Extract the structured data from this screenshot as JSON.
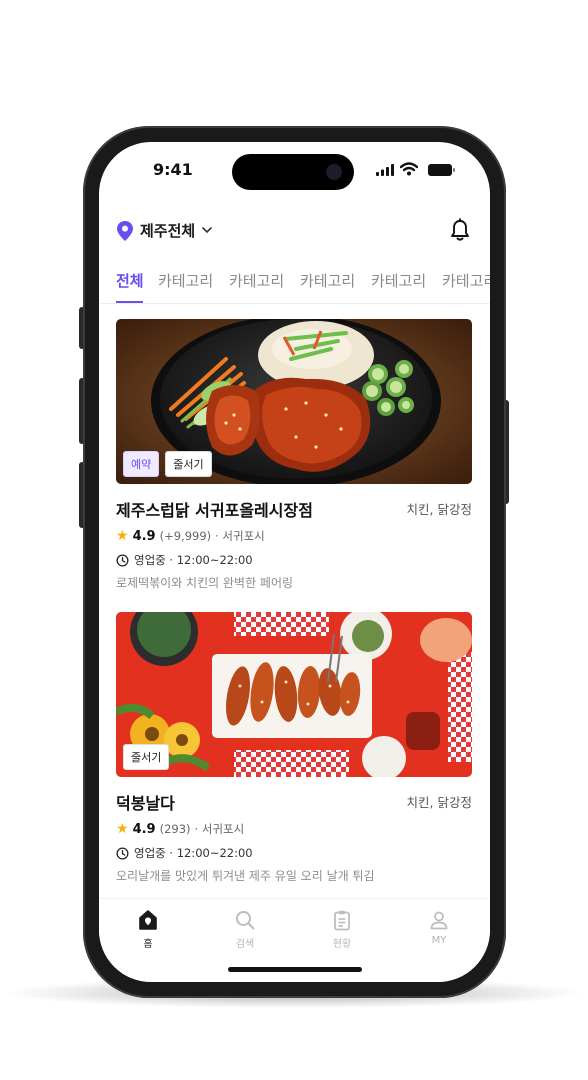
{
  "status_bar": {
    "time": "9:41"
  },
  "header": {
    "location": "제주전체",
    "location_icon": "map-pin-icon",
    "notification_icon": "bell-icon"
  },
  "tabs": [
    {
      "label": "전체",
      "active": true
    },
    {
      "label": "카테고리",
      "active": false
    },
    {
      "label": "카테고리",
      "active": false
    },
    {
      "label": "카테고리",
      "active": false
    },
    {
      "label": "카테고리",
      "active": false
    },
    {
      "label": "카테고리",
      "active": false
    }
  ],
  "stores": [
    {
      "badges": [
        "예약",
        "줄서기"
      ],
      "name": "제주스럽닭 서귀포올레시장점",
      "category": "치킨, 닭강정",
      "rating": "4.9",
      "reviews": "(+9,999)",
      "area": "· 서귀포시",
      "hours": "영업중 · 12:00~22:00",
      "description": "로제떡볶이와 치킨의 완벽한 페어링"
    },
    {
      "badges": [
        "줄서기"
      ],
      "name": "덕봉날다",
      "category": "치킨, 닭강정",
      "rating": "4.9",
      "reviews": "(293)",
      "area": "· 서귀포시",
      "hours": "영업중 · 12:00~22:00",
      "description": "오리날개를 맛있게 튀겨낸 제주 유일 오리 날개 튀김"
    }
  ],
  "bottom_nav": [
    {
      "label": "홈",
      "icon": "home-icon",
      "active": true
    },
    {
      "label": "검색",
      "icon": "search-icon",
      "active": false
    },
    {
      "label": "현황",
      "icon": "clipboard-icon",
      "active": false
    },
    {
      "label": "MY",
      "icon": "user-icon",
      "active": false
    }
  ],
  "colors": {
    "accent": "#6a4cf0",
    "star": "#f7b500",
    "text": "#111111",
    "muted": "#8c8c8c"
  }
}
